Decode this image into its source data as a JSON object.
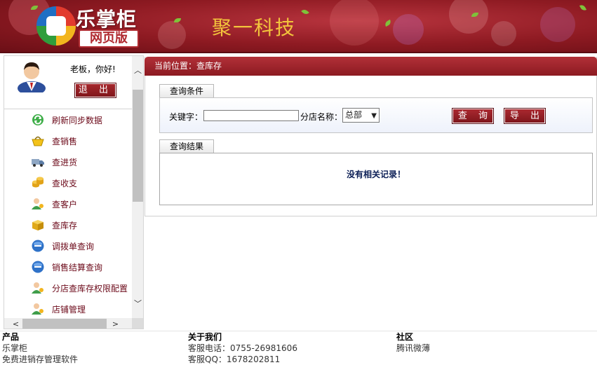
{
  "header": {
    "brand_name": "乐掌柜",
    "brand_badge": "网页版",
    "company_name": "聚一科技"
  },
  "sidebar": {
    "greeting": "老板，你好!",
    "logout_label": "退 出",
    "menu": [
      {
        "label": "刷新同步数据",
        "icon": "refresh-icon"
      },
      {
        "label": "查销售",
        "icon": "shopping-basket-icon"
      },
      {
        "label": "查进货",
        "icon": "delivery-truck-icon"
      },
      {
        "label": "查收支",
        "icon": "coins-icon"
      },
      {
        "label": "查客户",
        "icon": "customer-icon"
      },
      {
        "label": "查库存",
        "icon": "inventory-box-icon"
      },
      {
        "label": "调拨单查询",
        "icon": "circle-badge-icon"
      },
      {
        "label": "销售结算查询",
        "icon": "circle-badge-icon"
      },
      {
        "label": "分店查库存权限配置",
        "icon": "user-permission-icon"
      },
      {
        "label": "店铺管理",
        "icon": "user-permission-icon"
      }
    ]
  },
  "main": {
    "location": "当前位置：查库存",
    "query_section_title": "查询条件",
    "keyword_label": "关键字：",
    "keyword_value": "",
    "store_label": "分店名称：",
    "store_selected": "总部",
    "search_button": "查 询",
    "export_button": "导 出",
    "result_section_title": "查询结果",
    "no_records": "没有相关记录！"
  },
  "footer": {
    "products": {
      "title": "产品",
      "lines": [
        "乐掌柜",
        "免费进销存管理软件"
      ]
    },
    "about": {
      "title": "关于我们",
      "lines": [
        "客服电话：0755-26981606",
        "客服QQ：1678202811"
      ]
    },
    "community": {
      "title": "社区",
      "lines": [
        "腾讯微薄"
      ]
    }
  },
  "colors": {
    "brand_red": "#8e1a22",
    "menu_text": "#6c0a1a",
    "accent_gold": "#f2c33c"
  }
}
